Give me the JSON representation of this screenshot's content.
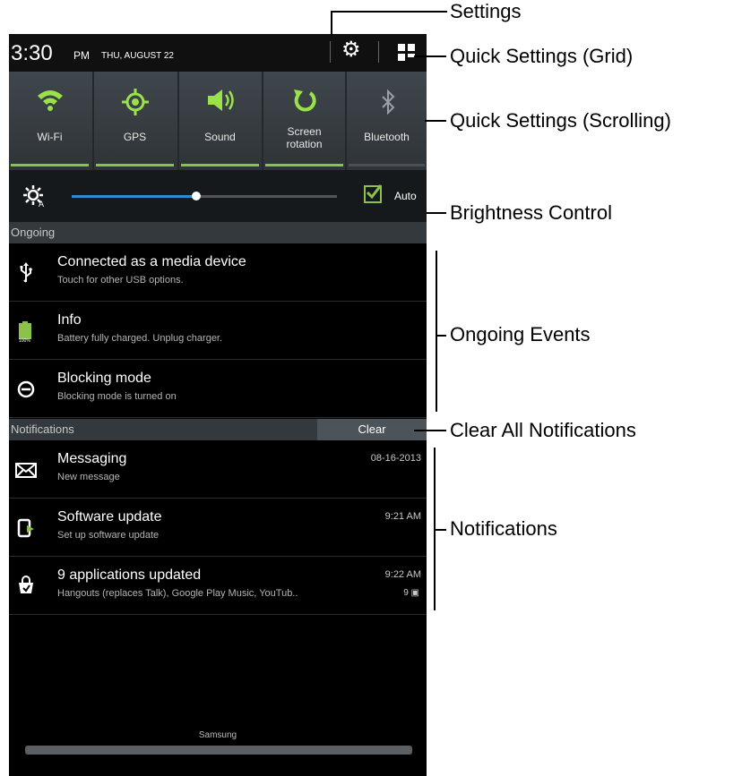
{
  "statusbar": {
    "time": "3:30",
    "ampm": "PM",
    "date": "THU, AUGUST 22"
  },
  "quick_settings": [
    {
      "label": "Wi-Fi",
      "icon": "wifi-icon",
      "active": true
    },
    {
      "label": "GPS",
      "icon": "gps-icon",
      "active": true
    },
    {
      "label": "Sound",
      "icon": "sound-icon",
      "active": true
    },
    {
      "label": "Screen rotation",
      "label_line1": "Screen",
      "label_line2": "rotation",
      "icon": "rotation-icon",
      "active": true
    },
    {
      "label": "Bluetooth",
      "icon": "bluetooth-icon",
      "active": false
    }
  ],
  "brightness": {
    "level": 0.47,
    "auto_label": "Auto",
    "auto_checked": true
  },
  "ongoing": {
    "header": "Ongoing",
    "items": [
      {
        "title": "Connected as a media device",
        "subtitle": "Touch for other USB options.",
        "icon": "usb-icon"
      },
      {
        "title": "Info",
        "subtitle": "Battery fully charged. Unplug charger.",
        "icon": "battery-icon"
      },
      {
        "title": "Blocking mode",
        "subtitle": "Blocking mode is turned on",
        "icon": "blocking-mode-icon"
      }
    ]
  },
  "notifications": {
    "header": "Notifications",
    "clear_label": "Clear",
    "items": [
      {
        "title": "Messaging",
        "subtitle": "New message",
        "time": "08-16-2013",
        "icon": "envelope-icon"
      },
      {
        "title": "Software update",
        "subtitle": "Set up software update",
        "time": "9:21 AM",
        "icon": "software-update-icon"
      },
      {
        "title": "9 applications updated",
        "subtitle": "Hangouts (replaces Talk), Google Play Music, YouTub..",
        "time": "9:22 AM",
        "count": "9",
        "icon": "play-store-icon"
      }
    ]
  },
  "carrier": "Samsung",
  "callouts": {
    "settings": "Settings",
    "qs_grid": "Quick Settings (Grid)",
    "qs_scrolling": "Quick Settings (Scrolling)",
    "brightness": "Brightness Control",
    "ongoing": "Ongoing Events",
    "clear_all": "Clear All Notifications",
    "notifications": "Notifications"
  },
  "colors": {
    "accent_green": "#8bc34a",
    "slider_blue": "#2f8bd0"
  }
}
